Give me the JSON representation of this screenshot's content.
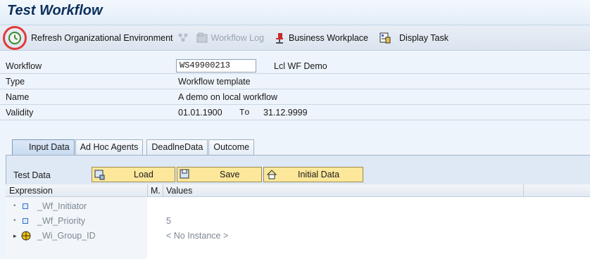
{
  "window": {
    "title": "Test Workflow"
  },
  "toolbar": {
    "refresh_label": "Refresh Organizational Environment",
    "workflow_log_label": "Workflow Log",
    "business_workplace_label": "Business Workplace",
    "display_task_label": "Display Task"
  },
  "fields": {
    "workflow": {
      "label": "Workflow",
      "value": "WS49900213",
      "text": "Lcl WF Demo"
    },
    "type": {
      "label": "Type",
      "value": "Workflow template"
    },
    "name": {
      "label": "Name",
      "value": "A demo on local workflow"
    },
    "validity": {
      "label": "Validity",
      "from": "01.01.1900",
      "to_label": "To",
      "to": "31.12.9999"
    }
  },
  "tabs": [
    {
      "label": "Input Data"
    },
    {
      "label": "Ad Hoc Agents"
    },
    {
      "label": "DeadlneData"
    },
    {
      "label": "Outcome"
    }
  ],
  "test_data": {
    "label": "Test Data",
    "load_label": "Load",
    "save_label": "Save",
    "initial_label": "Initial Data"
  },
  "tree": {
    "columns": {
      "expression": "Expression",
      "m": "M.",
      "values": "Values"
    },
    "rows": [
      {
        "name": "_Wf_Initiator",
        "value": ""
      },
      {
        "name": "_Wf_Priority",
        "value": "5"
      },
      {
        "name": "_Wi_Group_ID",
        "value": "< No Instance >"
      }
    ]
  },
  "colors": {
    "accent": "#fde79a",
    "highlight_circle": "#e23a3a"
  }
}
